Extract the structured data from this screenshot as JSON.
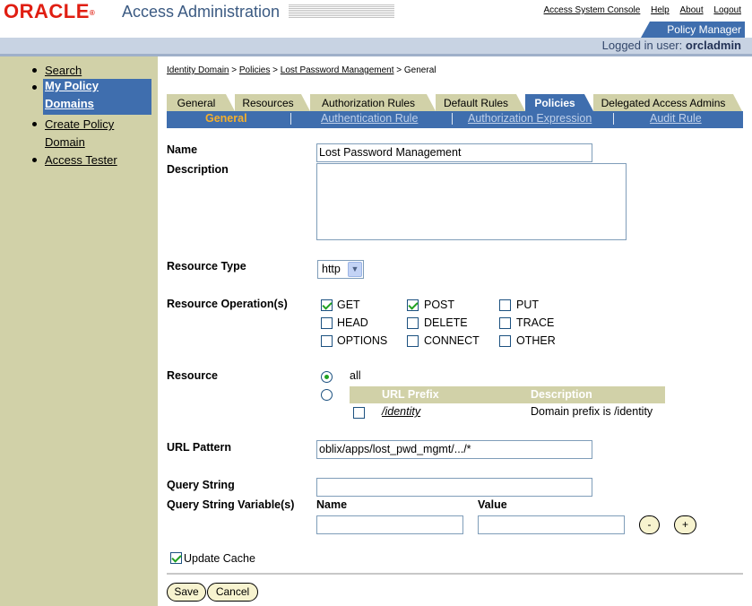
{
  "header": {
    "logo_text": "ORACLE",
    "logo_reg": "®",
    "app_title": "Access Administration",
    "top_links": [
      "Access System Console",
      "Help",
      "About",
      "Logout"
    ],
    "policy_manager_tab": "Policy Manager",
    "logged_in_label": "Logged in user:",
    "logged_in_user": "orcladmin"
  },
  "sidebar": {
    "items": [
      {
        "label": "Search"
      },
      {
        "label_line1": "My Policy",
        "label_line2": "Domains",
        "active": true
      },
      {
        "label_line1": "Create Policy",
        "label_line2": "Domain"
      },
      {
        "label": "Access Tester"
      }
    ]
  },
  "breadcrumb": {
    "items": [
      "Identity Domain",
      "Policies",
      "Lost Password Management",
      "General"
    ],
    "separator": ">"
  },
  "tabs": [
    {
      "label": "General"
    },
    {
      "label": "Resources"
    },
    {
      "label": "Authorization Rules"
    },
    {
      "label": "Default Rules"
    },
    {
      "label": "Policies",
      "active": true
    },
    {
      "label": "Delegated Access Admins"
    }
  ],
  "subtabs": [
    {
      "label": "General",
      "active": true
    },
    {
      "label": "Authentication Rule"
    },
    {
      "label": "Authorization Expression"
    },
    {
      "label": "Audit Rule"
    }
  ],
  "form": {
    "name_label": "Name",
    "name_value": "Lost Password Management",
    "description_label": "Description",
    "description_value": "",
    "resource_type_label": "Resource Type",
    "resource_type_value": "http",
    "resource_ops_label": "Resource Operation(s)",
    "operations": [
      {
        "label": "GET",
        "checked": true
      },
      {
        "label": "POST",
        "checked": true
      },
      {
        "label": "PUT",
        "checked": false
      },
      {
        "label": "HEAD",
        "checked": false
      },
      {
        "label": "DELETE",
        "checked": false
      },
      {
        "label": "TRACE",
        "checked": false
      },
      {
        "label": "OPTIONS",
        "checked": false
      },
      {
        "label": "CONNECT",
        "checked": false
      },
      {
        "label": "OTHER",
        "checked": false
      }
    ],
    "resource_label": "Resource",
    "resource_all_label": "all",
    "resource_table": {
      "headers": [
        "URL Prefix",
        "Description"
      ],
      "rows": [
        {
          "prefix": "/identity",
          "description": "Domain prefix is /identity"
        }
      ]
    },
    "url_pattern_label": "URL Pattern",
    "url_pattern_value": "oblix/apps/lost_pwd_mgmt/.../*",
    "query_string_label": "Query String",
    "query_string_value": "",
    "query_vars_label": "Query String Variable(s)",
    "query_name_label": "Name",
    "query_value_label": "Value",
    "remove_label": "-",
    "add_label": "+",
    "update_cache_label": "Update Cache",
    "update_cache_checked": true,
    "save_label": "Save",
    "cancel_label": "Cancel"
  },
  "colors": {
    "oracle_red": "#e01e12",
    "accent_blue": "#3f6eae",
    "nav_khaki": "#d1d1a8",
    "active_subtab": "#f5b02c"
  }
}
